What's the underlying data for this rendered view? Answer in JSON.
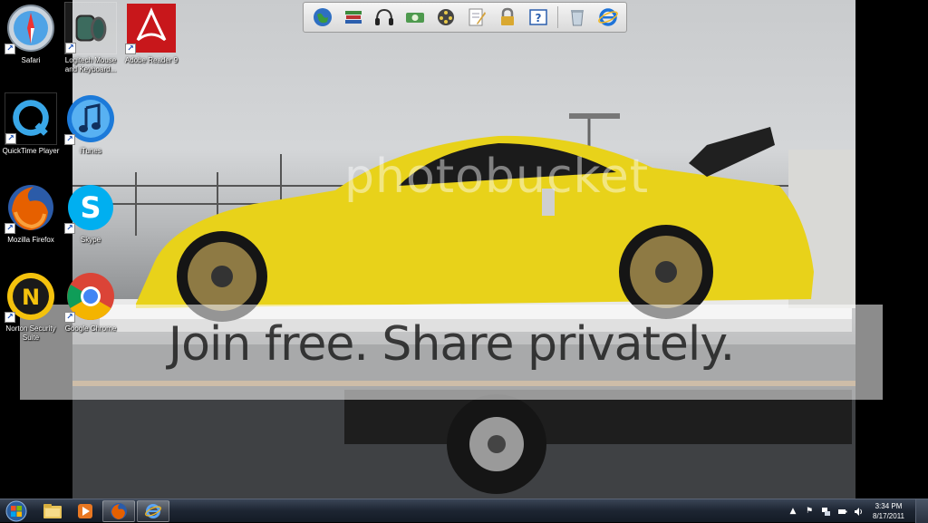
{
  "desktop": {
    "icons": [
      {
        "label": "Safari",
        "icon": "safari-icon"
      },
      {
        "label": "Logitech Mouse and Keyboard...",
        "icon": "logitech-icon"
      },
      {
        "label": "Adobe Reader 9",
        "icon": "adobe-reader-icon"
      },
      {
        "label": "QuickTime Player",
        "icon": "quicktime-icon"
      },
      {
        "label": "iTunes",
        "icon": "itunes-icon"
      },
      {
        "label": "Mozilla Firefox",
        "icon": "firefox-icon"
      },
      {
        "label": "Skype",
        "icon": "skype-icon"
      },
      {
        "label": "Norton Security Suite",
        "icon": "norton-icon"
      },
      {
        "label": "Google Chrome",
        "icon": "chrome-icon"
      }
    ]
  },
  "wallpaper": {
    "watermark_logo": "photobucket",
    "watermark_tagline": "Join free. Share privately."
  },
  "toolbar": {
    "buttons": [
      "globe-icon",
      "books-icon",
      "headphones-icon",
      "money-icon",
      "film-reel-icon",
      "notepad-icon",
      "lock-icon",
      "help-icon",
      "recycle-bin-icon",
      "internet-explorer-icon"
    ]
  },
  "taskbar": {
    "pinned": [
      "windows-explorer-icon",
      "media-player-icon",
      "firefox-icon",
      "internet-explorer-icon"
    ],
    "clock_time": "3:34 PM",
    "clock_date": "8/17/2011"
  },
  "colors": {
    "car_yellow": "#e8d21a",
    "taskbar": "#1d2532"
  }
}
